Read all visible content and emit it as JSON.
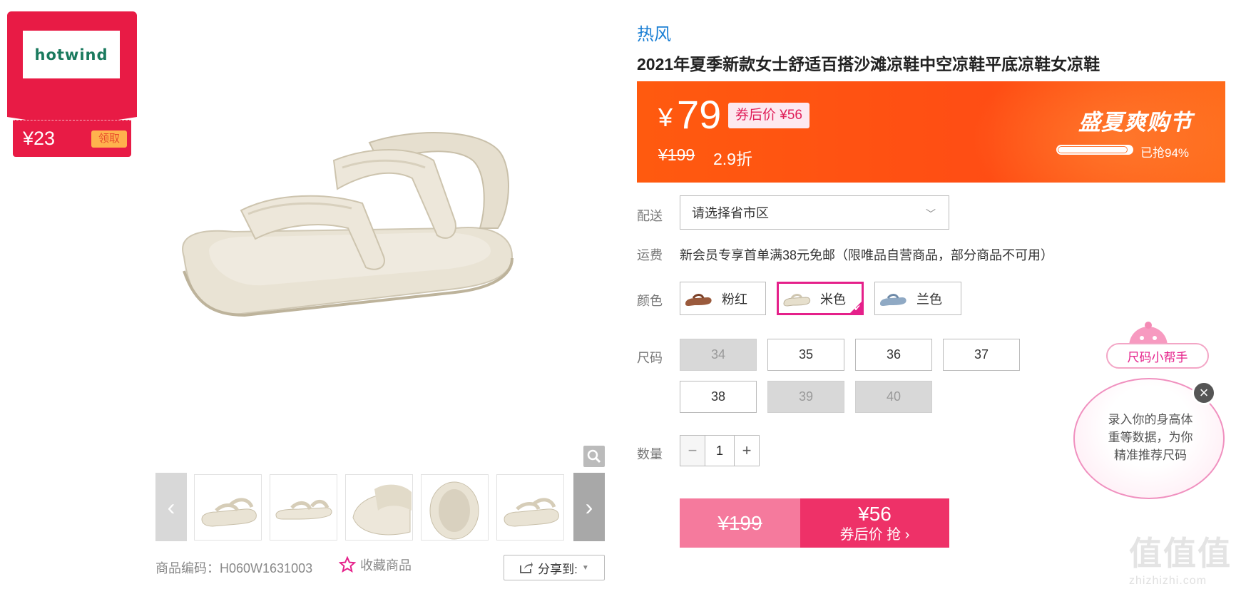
{
  "brand_coupon": {
    "logo_text": "hotwind",
    "amount": "¥23",
    "get_label": "领取",
    "color": "#e81b45"
  },
  "gallery": {
    "prev_icon": "chevron-left-icon",
    "next_icon": "chevron-right-icon",
    "thumbnails": [
      "thumb-1",
      "thumb-2",
      "thumb-3",
      "thumb-4",
      "thumb-5"
    ]
  },
  "meta": {
    "code": "商品编码：H060W1631003",
    "favorite": "收藏商品",
    "share": "分享到:"
  },
  "product": {
    "brand": "热风",
    "title": "2021年夏季新款女士舒适百搭沙滩凉鞋中空凉鞋平底凉鞋女凉鞋"
  },
  "price": {
    "currency": "¥",
    "current": "79",
    "coupon_price": "券后价 ¥56",
    "original": "¥199",
    "discount": "2.9折",
    "promo_title": "盛夏爽购节",
    "sold_fraction": 0.94,
    "sold_text": "已抢94%"
  },
  "delivery": {
    "label": "配送",
    "placeholder": "请选择省市区"
  },
  "shipping": {
    "label": "运费",
    "text": "新会员专享首单满38元免邮（限唯品自营商品，部分商品不可用）"
  },
  "color": {
    "label": "颜色",
    "options": [
      {
        "name": "粉红",
        "selected": false
      },
      {
        "name": "米色",
        "selected": true
      },
      {
        "name": "兰色",
        "selected": false
      }
    ]
  },
  "size": {
    "label": "尺码",
    "options": [
      {
        "value": "34",
        "available": false
      },
      {
        "value": "35",
        "available": true
      },
      {
        "value": "36",
        "available": true
      },
      {
        "value": "37",
        "available": true
      },
      {
        "value": "38",
        "available": true
      },
      {
        "value": "39",
        "available": false
      },
      {
        "value": "40",
        "available": false
      }
    ]
  },
  "quantity": {
    "label": "数量",
    "value": "1",
    "minus": "−",
    "plus": "+"
  },
  "buy": {
    "original": "¥199",
    "coupon_price": "¥56",
    "action": "券后价 抢 ›"
  },
  "size_helper": {
    "tag": "尺码小帮手",
    "lines": [
      "录入你的身高体",
      "重等数据，为你",
      "精准推荐尺码"
    ],
    "close": "×"
  },
  "watermark": {
    "main": "值值值",
    "sub": "zhizhizhi.com"
  }
}
